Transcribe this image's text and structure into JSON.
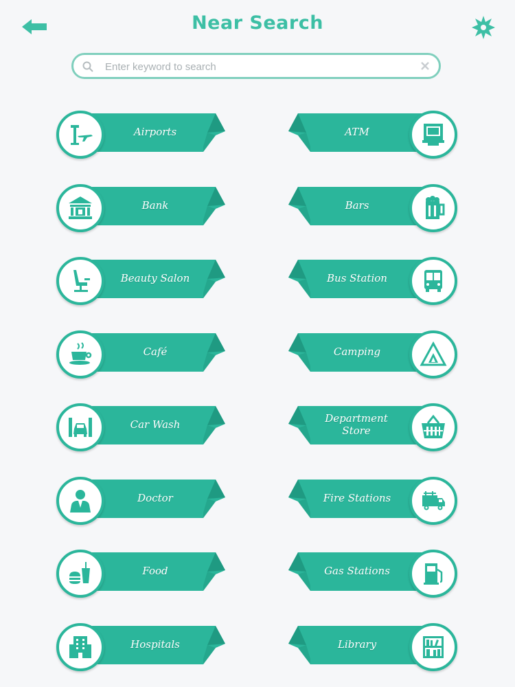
{
  "header": {
    "title": "Near Search",
    "back_icon": "arrow-left-icon",
    "settings_icon": "gear-icon"
  },
  "search": {
    "placeholder": "Enter keyword to search",
    "value": "",
    "search_icon": "search-icon",
    "clear_icon": "clear-icon"
  },
  "colors": {
    "accent": "#3dbfa5",
    "ribbon": "#2bb69b",
    "ribbon_fold": "#1f9a82",
    "background": "#f6f7f9"
  },
  "categories": [
    {
      "label": "Airports",
      "icon": "airport-icon"
    },
    {
      "label": "ATM",
      "icon": "atm-icon"
    },
    {
      "label": "Bank",
      "icon": "bank-icon"
    },
    {
      "label": "Bars",
      "icon": "beer-icon"
    },
    {
      "label": "Beauty Salon",
      "icon": "salon-chair-icon"
    },
    {
      "label": "Bus Station",
      "icon": "bus-icon"
    },
    {
      "label": "Café",
      "icon": "coffee-cup-icon"
    },
    {
      "label": "Camping",
      "icon": "tent-icon"
    },
    {
      "label": "Car Wash",
      "icon": "car-wash-icon"
    },
    {
      "label": "Department Store",
      "icon": "shopping-basket-icon"
    },
    {
      "label": "Doctor",
      "icon": "doctor-icon"
    },
    {
      "label": "Fire Stations",
      "icon": "fire-truck-icon"
    },
    {
      "label": "Food",
      "icon": "fast-food-icon"
    },
    {
      "label": "Gas Stations",
      "icon": "gas-pump-icon"
    },
    {
      "label": "Hospitals",
      "icon": "hospital-icon"
    },
    {
      "label": "Library",
      "icon": "bookshelf-icon"
    }
  ]
}
